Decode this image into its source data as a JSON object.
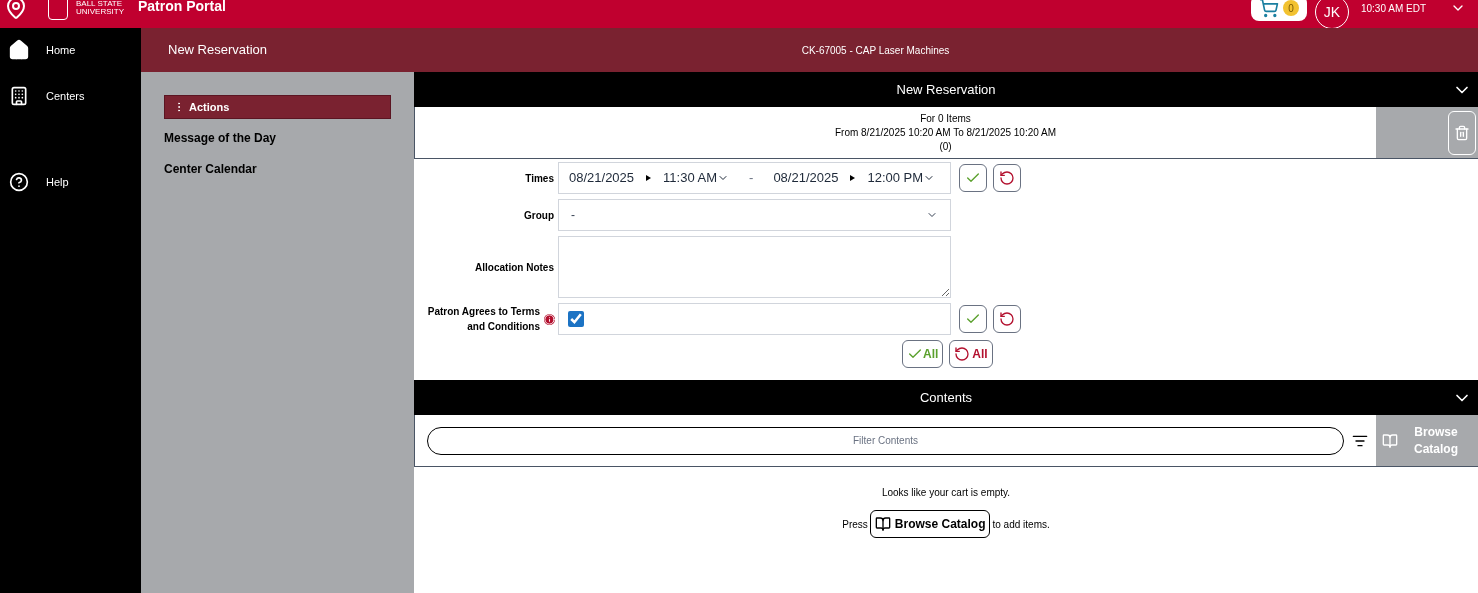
{
  "header": {
    "org": "BALL STATE UNIVERSITY",
    "title": "Patron Portal",
    "cart_count": "0",
    "avatar": "JK",
    "time": "10:30 AM EDT"
  },
  "nav": [
    {
      "kind": "home",
      "label": "Home"
    },
    {
      "kind": "centers",
      "label": "Centers"
    },
    {
      "kind": "help",
      "label": "Help"
    }
  ],
  "subheader": {
    "title": "New Reservation",
    "resource": "CK-67005 - CAP Laser Machines"
  },
  "actions": {
    "title": "Actions",
    "items": [
      "Message of the Day",
      "Center Calendar"
    ]
  },
  "reservation": {
    "title": "New Reservation",
    "expanded": true,
    "summary": [
      "For 0 Items",
      "From 8/21/2025 10:20 AM To 8/21/2025 10:20 AM",
      "(0)"
    ],
    "times": {
      "label": "Times",
      "start_date": "08/21/2025",
      "start_time": "11:30 AM",
      "separator": "-",
      "end_date": "08/21/2025",
      "end_time": "12:00 PM"
    },
    "group": {
      "label": "Group",
      "value": "-"
    },
    "notes": {
      "label": "Allocation Notes"
    },
    "terms": {
      "label": "Patron Agrees to Terms and Conditions",
      "checked": true
    },
    "all_buttons": [
      "All",
      "All"
    ]
  },
  "contents": {
    "title": "Contents",
    "expanded": true,
    "filter_placeholder": "Filter Contents",
    "browse_button": "Browse Catalog",
    "empty": "Looks like your cart is empty.",
    "press": "Press",
    "browse_inline": "Browse Catalog",
    "suffix": "to add items."
  }
}
